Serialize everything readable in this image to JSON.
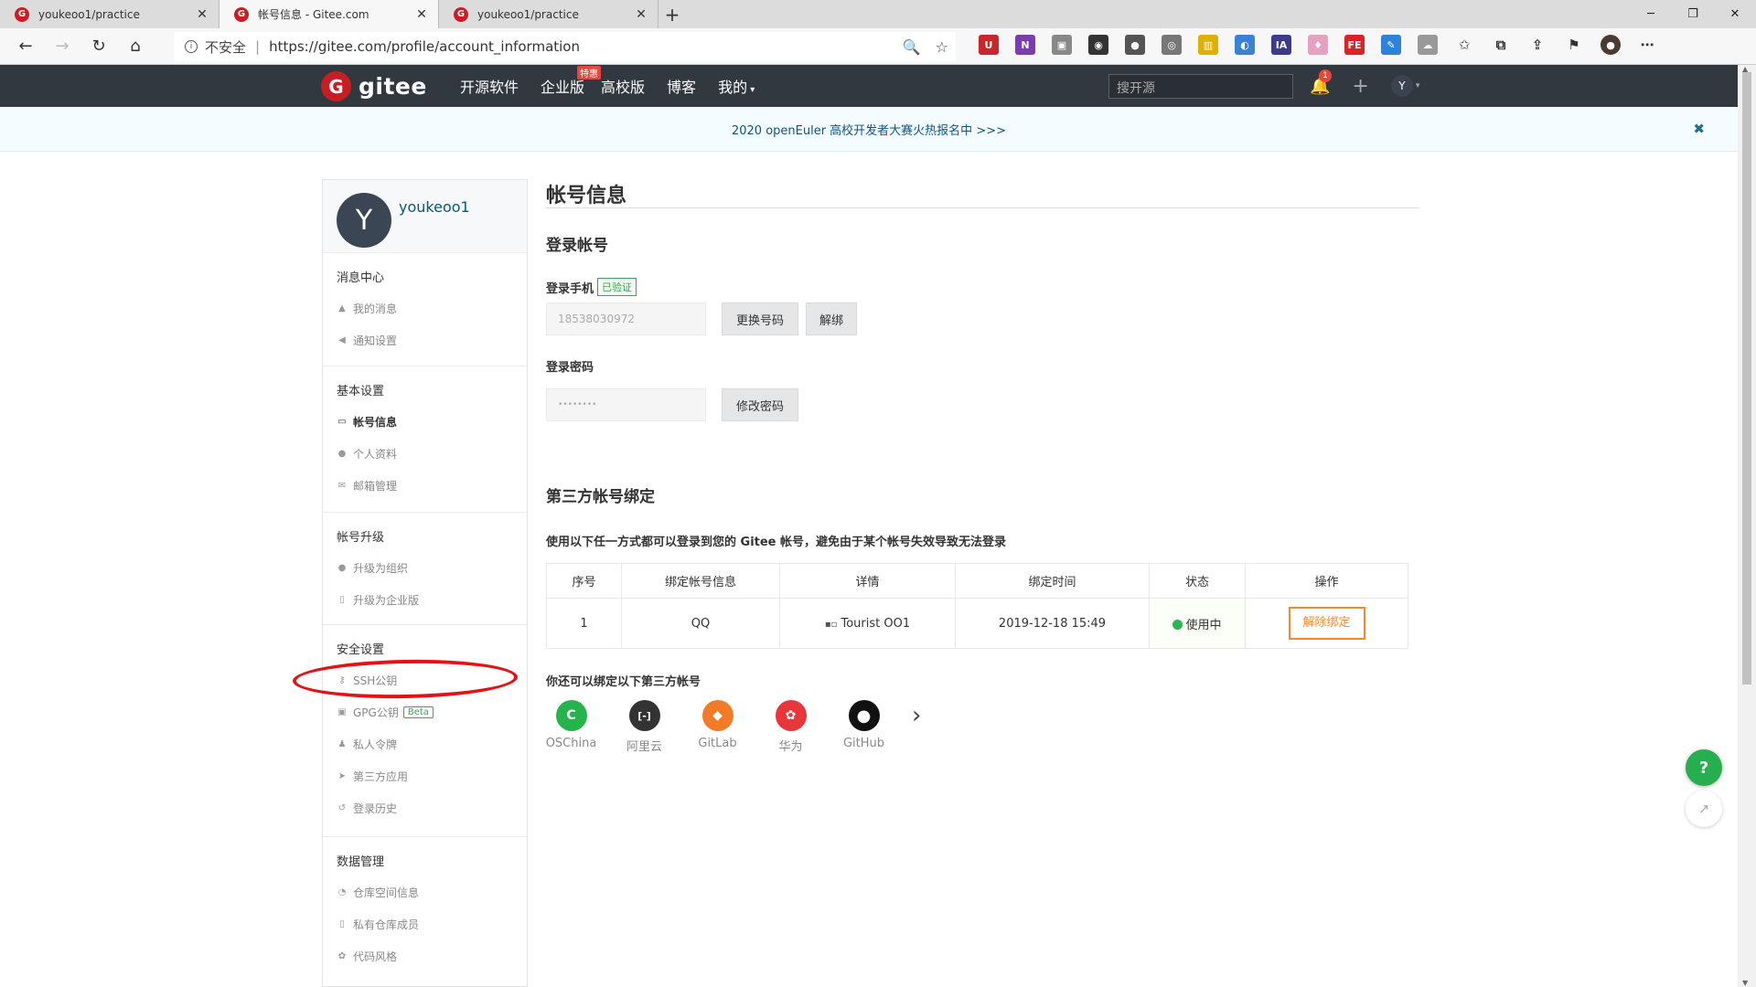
{
  "browser": {
    "tabs": [
      {
        "title": "youkeoo1/practice",
        "favicon": "gitee-icon"
      },
      {
        "title": "帐号信息 - Gitee.com",
        "favicon": "gitee-icon"
      },
      {
        "title": "youkeoo1/practice",
        "favicon": "gitee-icon"
      }
    ],
    "insecure_label": "不安全",
    "url": "https://gitee.com/profile/account_information"
  },
  "header": {
    "logo_text": "gitee",
    "nav": [
      "开源软件",
      "企业版",
      "高校版",
      "博客",
      "我的"
    ],
    "hot_badge": "特惠",
    "search_placeholder": "搜开源",
    "notification_count": "1",
    "user_initial": "Y"
  },
  "announcement": {
    "text": "2020 openEuler 高校开发者大赛火热报名中 >>>"
  },
  "sidebar": {
    "avatar_initial": "Y",
    "username": "youkeoo1",
    "sections": [
      {
        "title": "消息中心",
        "items": [
          {
            "label": "我的消息",
            "icon": "bell-icon"
          },
          {
            "label": "通知设置",
            "icon": "volume-icon"
          }
        ]
      },
      {
        "title": "基本设置",
        "items": [
          {
            "label": "帐号信息",
            "icon": "id-card-icon"
          },
          {
            "label": "个人资料",
            "icon": "user-icon"
          },
          {
            "label": "邮箱管理",
            "icon": "mail-icon"
          }
        ]
      },
      {
        "title": "帐号升级",
        "items": [
          {
            "label": "升级为组织",
            "icon": "users-icon"
          },
          {
            "label": "升级为企业版",
            "icon": "building-icon"
          }
        ]
      },
      {
        "title": "安全设置",
        "items": [
          {
            "label": "SSH公钥",
            "icon": "key-icon"
          },
          {
            "label": "GPG公钥",
            "icon": "lock-icon"
          },
          {
            "label": "私人令牌",
            "icon": "token-icon"
          },
          {
            "label": "第三方应用",
            "icon": "rocket-icon"
          },
          {
            "label": "登录历史",
            "icon": "history-icon"
          }
        ]
      },
      {
        "title": "数据管理",
        "items": [
          {
            "label": "仓库空间信息",
            "icon": "pie-icon"
          },
          {
            "label": "私有仓库成员",
            "icon": "repo-icon"
          },
          {
            "label": "代码风格",
            "icon": "palette-icon"
          }
        ]
      }
    ],
    "beta_label": "Beta"
  },
  "main": {
    "title": "帐号信息",
    "login_account_heading": "登录帐号",
    "phone_label": "登录手机",
    "verified_label": "已验证",
    "phone_value": "18538030972",
    "change_phone_button": "更换号码",
    "unbind_phone_button": "解绑",
    "password_label": "登录密码",
    "password_value": "••••••••",
    "change_password_button": "修改密码",
    "third_party_heading": "第三方帐号绑定",
    "third_party_desc": "使用以下任一方式都可以登录到您的 Gitee 帐号，避免由于某个帐号失效导致无法登录",
    "table": {
      "headers": [
        "序号",
        "绑定帐号信息",
        "详情",
        "绑定时间",
        "状态",
        "操作"
      ],
      "rows": [
        {
          "index": "1",
          "account": "QQ",
          "detail": "Tourist OO1",
          "time": "2019-12-18 15:49",
          "status": "使用中",
          "action": "解除绑定"
        }
      ]
    },
    "more_heading": "你还可以绑定以下第三方帐号",
    "providers": [
      {
        "name": "OSChina",
        "color": "#26b34c",
        "glyph": "C"
      },
      {
        "name": "阿里云",
        "color": "#333333",
        "glyph": "[-]"
      },
      {
        "name": "GitLab",
        "color": "#f47b25",
        "glyph": "◆"
      },
      {
        "name": "华为",
        "color": "#e8363a",
        "glyph": "✿"
      },
      {
        "name": "GitHub",
        "color": "#111111",
        "glyph": "●"
      }
    ]
  },
  "floating": {
    "help_label": "?"
  }
}
